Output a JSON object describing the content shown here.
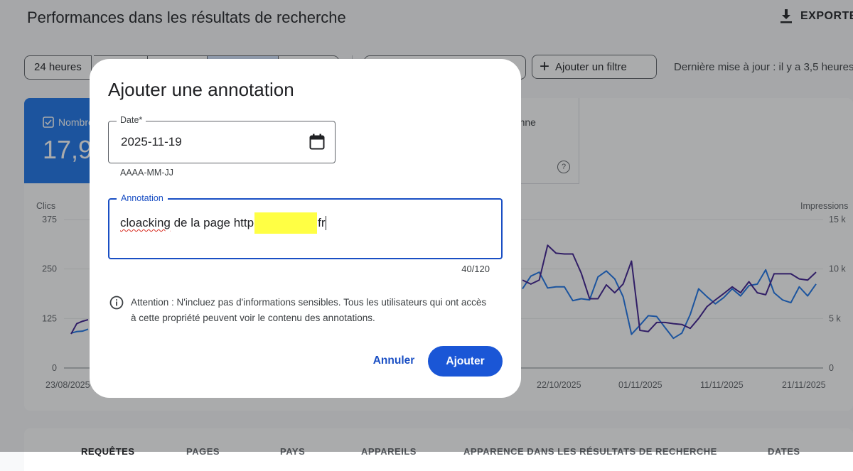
{
  "page": {
    "title": "Performances dans les résultats de recherche",
    "export_label": "EXPORTER",
    "date_chip": "24 heures",
    "add_filter_label": "Ajouter un filtre",
    "last_update": "Dernière mise à jour : il y a 3,5 heures",
    "metric_clicks_label": "Nombre",
    "metric_clicks_value": "17,9",
    "metric_position_label": "oyenne",
    "metric_help": "?",
    "tabs": [
      "REQUÊTES",
      "PAGES",
      "PAYS",
      "APPAREILS",
      "APPARENCE DANS LES RÉSULTATS DE RECHERCHE",
      "DATES"
    ]
  },
  "chart_data": {
    "type": "line",
    "ylabel_left": "Clics",
    "ylabel_right": "Impressions",
    "left_ticks": [
      "375",
      "250",
      "125",
      "0"
    ],
    "right_ticks": [
      "15 k",
      "10 k",
      "5 k",
      "0"
    ],
    "x_ticks": [
      "23/08/2025",
      "22/10/2025",
      "01/11/2025",
      "11/11/2025",
      "21/11/2025"
    ],
    "ylim_left": [
      0,
      375
    ],
    "ylim_right": [
      0,
      15000
    ],
    "series": [
      {
        "color": "#1a73e8",
        "left_visible": [
          88,
          92,
          93,
          98
        ],
        "values": [
          200,
          232,
          242,
          202,
          205,
          205,
          170,
          175,
          172,
          230,
          245,
          225,
          180,
          85,
          108,
          132,
          130,
          102,
          75,
          88,
          135,
          200,
          180,
          162,
          178,
          200,
          182,
          208,
          212,
          248,
          190,
          172,
          165,
          205,
          182,
          212
        ]
      },
      {
        "color": "#3c1c8f",
        "left_visible": [
          86,
          112,
          118,
          122
        ],
        "values": [
          222,
          212,
          222,
          310,
          290,
          288,
          288,
          240,
          175,
          175,
          210,
          190,
          212,
          270,
          95,
          92,
          115,
          115,
          112,
          110,
          100,
          125,
          155,
          172,
          188,
          205,
          190,
          218,
          190,
          185,
          238,
          238,
          238,
          225,
          222,
          242
        ]
      }
    ]
  },
  "dialog": {
    "title": "Ajouter une annotation",
    "date_label": "Date*",
    "date_value": "2025-11-19",
    "date_helper": "AAAA-MM-JJ",
    "annotation_label": "Annotation",
    "annotation_word1": "cloacking",
    "annotation_middle": " de la page http",
    "annotation_end": "fr",
    "counter": "40/120",
    "warning": "Attention : N'incluez pas d'informations sensibles. Tous les utilisateurs qui ont accès à cette propriété peuvent voir le contenu des annotations.",
    "cancel_label": "Annuler",
    "add_label": "Ajouter"
  },
  "colors": {
    "primary": "#1a4fc4",
    "metric_blue": "#1a73e8",
    "redaction": "#ffff44"
  }
}
